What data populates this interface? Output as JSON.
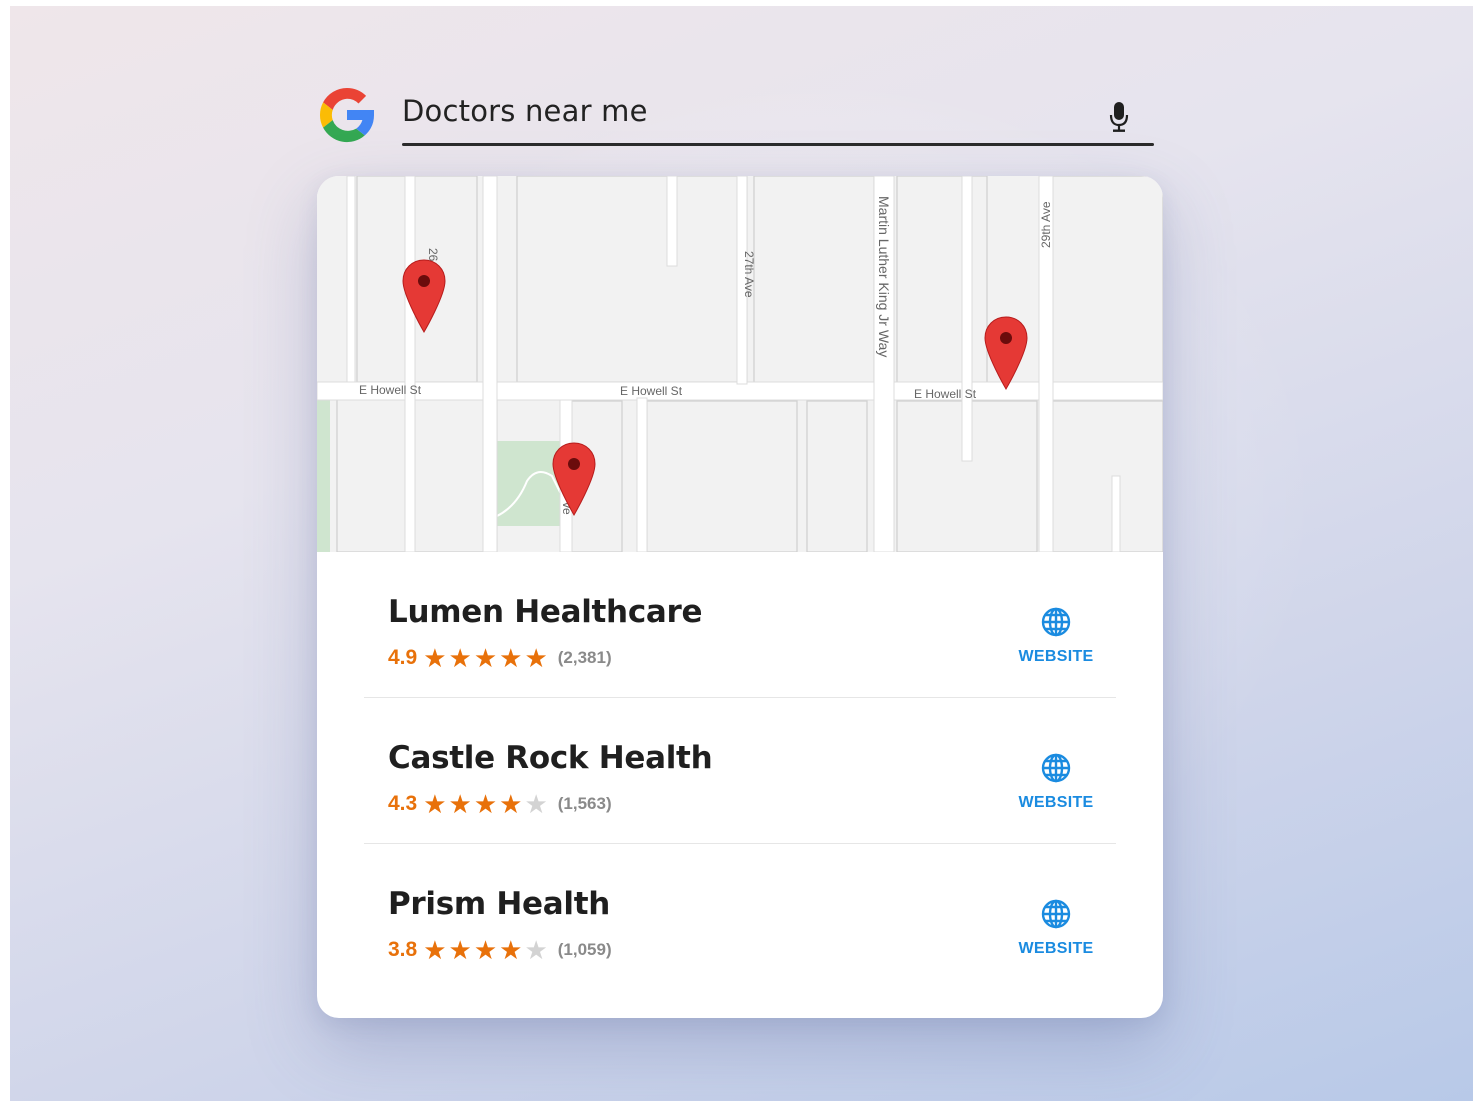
{
  "search": {
    "query": "Doctors near me",
    "logo_icon": "google-g-icon",
    "mic_icon": "microphone-icon"
  },
  "map": {
    "streets": [
      "E Howell St",
      "E Howell St",
      "E Howell St",
      "27th Ave",
      "Martin Luther King Jr Way",
      "29th Ave",
      "26",
      "ve"
    ],
    "pin_icon": "map-pin-icon",
    "pin_count": 3
  },
  "results": [
    {
      "name": "Lumen Healthcare",
      "rating": "4.9",
      "stars": 5,
      "reviews": "(2,381)",
      "website_label": "WEBSITE"
    },
    {
      "name": "Castle Rock Health",
      "rating": "4.3",
      "stars": 4,
      "reviews": "(1,563)",
      "website_label": "WEBSITE"
    },
    {
      "name": "Prism Health",
      "rating": "3.8",
      "stars": 4,
      "reviews": "(1,059)",
      "website_label": "WEBSITE"
    }
  ],
  "colors": {
    "rating_orange": "#e8710a",
    "website_blue": "#1a8be0",
    "pin_red": "#e53935"
  }
}
